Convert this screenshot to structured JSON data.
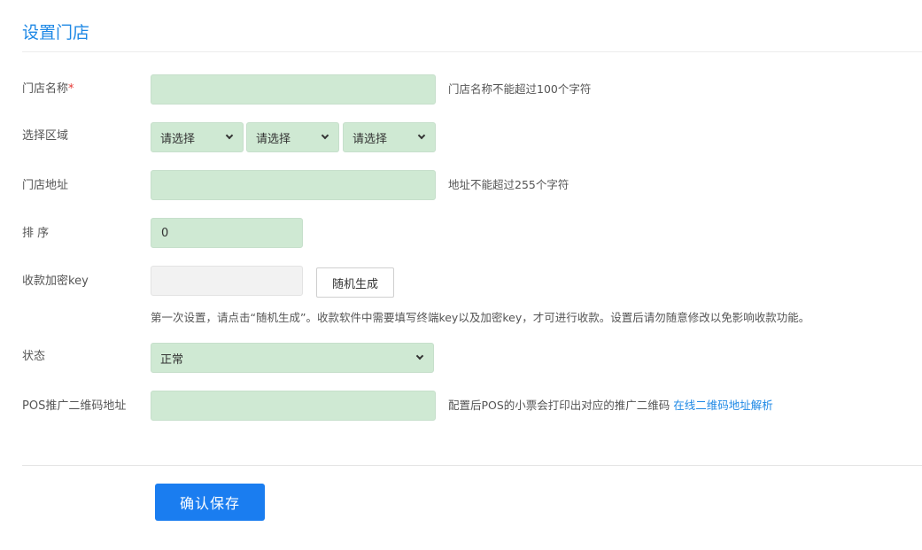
{
  "page": {
    "title": "设置门店"
  },
  "form": {
    "store_name": {
      "label": "门店名称",
      "required_mark": "*",
      "value": "",
      "hint": "门店名称不能超过100个字符"
    },
    "region": {
      "label": "选择区域",
      "selects": [
        "请选择",
        "请选择",
        "请选择"
      ]
    },
    "address": {
      "label": "门店地址",
      "value": "",
      "hint": "地址不能超过255个字符"
    },
    "sort": {
      "label": "排 序",
      "value": "0"
    },
    "pay_key": {
      "label": "收款加密key",
      "value": "",
      "generate_label": "随机生成",
      "hint": "第一次设置，请点击“随机生成”。收款软件中需要填写终端key以及加密key，才可进行收款。设置后请勿随意修改以免影响收款功能。"
    },
    "status": {
      "label": "状态",
      "value": "正常"
    },
    "pos_qr": {
      "label": "POS推广二维码地址",
      "value": "",
      "hint": "配置后POS的小票会打印出对应的推广二维码",
      "link": "在线二维码地址解析"
    }
  },
  "actions": {
    "save_label": "确认保存"
  },
  "colors": {
    "accent": "#1e88e5",
    "input_bg": "#cfe9d3",
    "primary_button": "#1a7df0",
    "required": "#e53935"
  }
}
